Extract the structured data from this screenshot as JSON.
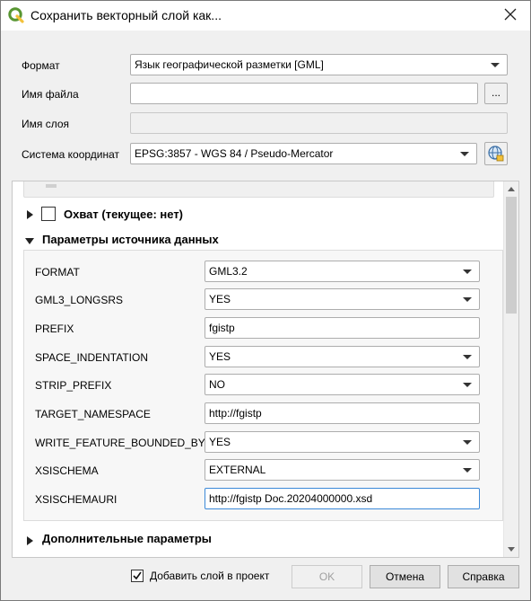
{
  "window": {
    "title": "Сохранить векторный слой как..."
  },
  "form": {
    "format_label": "Формат",
    "format_value": "Язык географической разметки [GML]",
    "filename_label": "Имя файла",
    "filename_value": "",
    "browse_label": "...",
    "layername_label": "Имя слоя",
    "layername_value": "",
    "crs_label": "Система координат",
    "crs_value": "EPSG:3857 - WGS 84 / Pseudo-Mercator"
  },
  "sections": {
    "extent_label": "Охват (текущее: нет)",
    "datasource_label": "Параметры источника данных",
    "advanced_label": "Дополнительные параметры"
  },
  "params": [
    {
      "name": "FORMAT",
      "kind": "combo",
      "value": "GML3.2"
    },
    {
      "name": "GML3_LONGSRS",
      "kind": "combo",
      "value": "YES"
    },
    {
      "name": "PREFIX",
      "kind": "text",
      "value": "fgistp"
    },
    {
      "name": "SPACE_INDENTATION",
      "kind": "combo",
      "value": "YES"
    },
    {
      "name": "STRIP_PREFIX",
      "kind": "combo",
      "value": "NO"
    },
    {
      "name": "TARGET_NAMESPACE",
      "kind": "text",
      "value": "http://fgistp"
    },
    {
      "name": "WRITE_FEATURE_BOUNDED_BY",
      "kind": "combo",
      "value": "YES"
    },
    {
      "name": "XSISCHEMA",
      "kind": "combo",
      "value": "EXTERNAL"
    },
    {
      "name": "XSISCHEMAURI",
      "kind": "text",
      "value": "http://fgistp Doc.20204000000.xsd"
    }
  ],
  "footer": {
    "add_to_project_label": "Добавить слой в проект",
    "add_to_project_checked": true,
    "ok_label": "OK",
    "cancel_label": "Отмена",
    "help_label": "Справка"
  },
  "icons": {
    "app": "qgis-logo-icon",
    "close": "close-icon",
    "crs": "globe-crs-icon"
  },
  "colors": {
    "accent_green": "#589632",
    "focus_blue": "#3b89d8",
    "crs_icon_yellow": "#f3c13a"
  }
}
